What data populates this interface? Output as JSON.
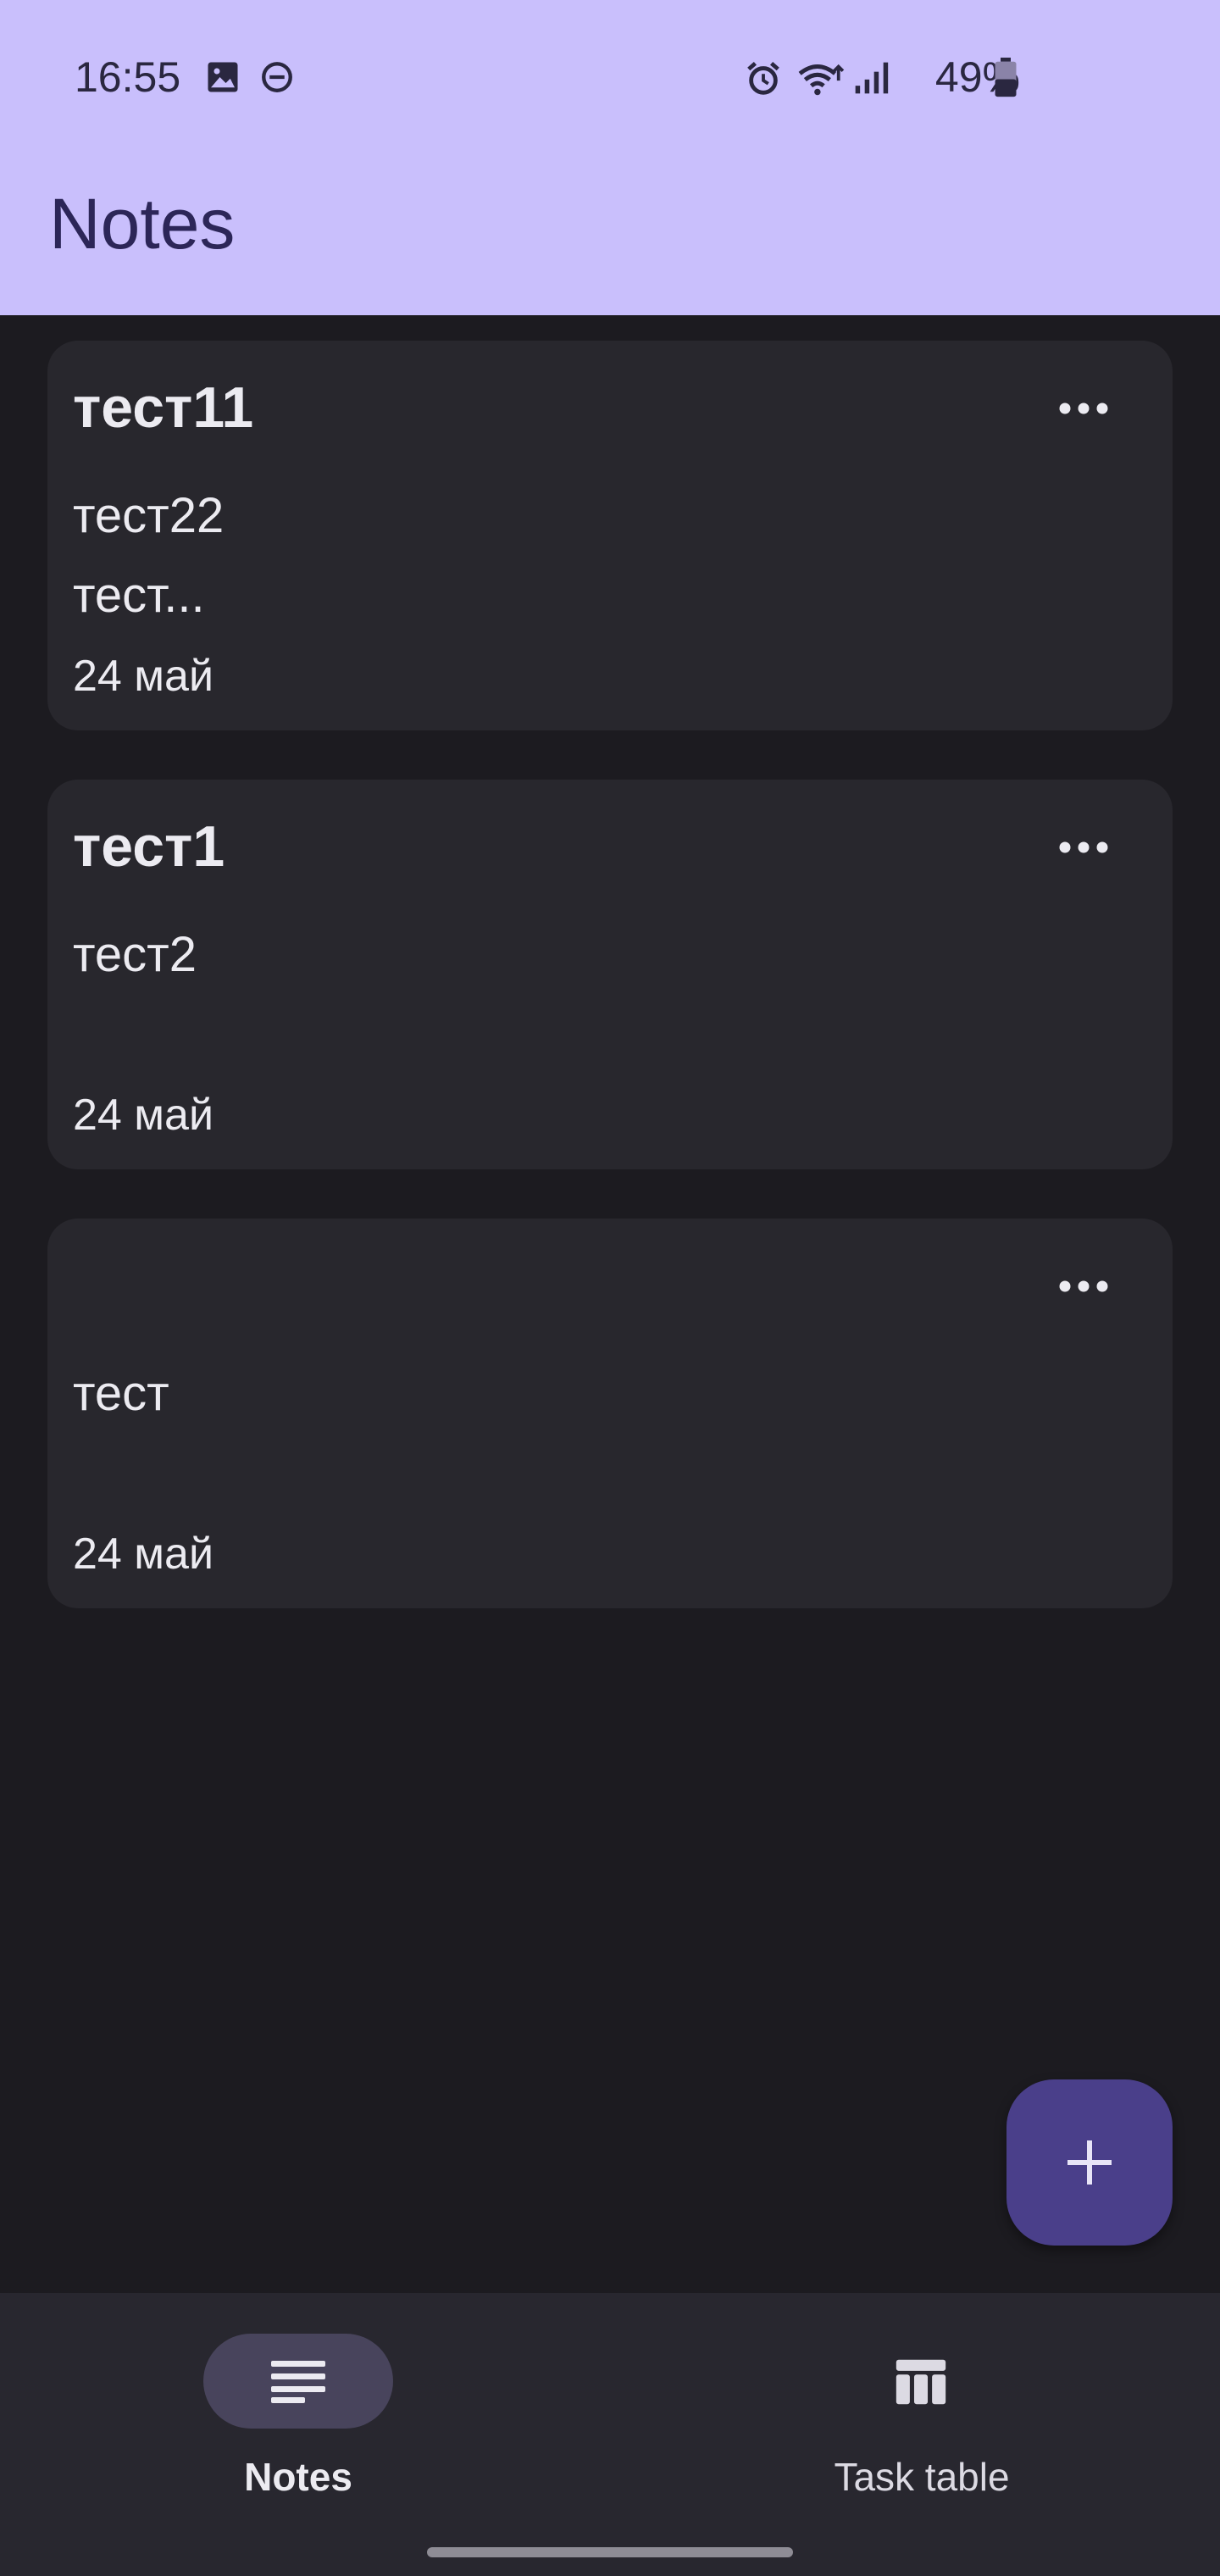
{
  "status_bar": {
    "time": "16:55",
    "battery": "49%",
    "left_icons": [
      "image-icon",
      "dnd-icon"
    ],
    "right_icons": [
      "alarm-icon",
      "wifi-icon",
      "signal-icon",
      "battery-icon"
    ]
  },
  "app_bar": {
    "title": "Notes"
  },
  "notes": [
    {
      "title": "тест11",
      "body": "тест22\nтест...",
      "date": "24 май"
    },
    {
      "title": "тест1",
      "body": "тест2",
      "date": "24 май"
    },
    {
      "title": "",
      "body": "тест",
      "date": "24 май"
    }
  ],
  "fab": {
    "icon": "plus-icon"
  },
  "bottom_nav": {
    "items": [
      {
        "label": "Notes",
        "icon": "notes-icon",
        "active": true
      },
      {
        "label": "Task table",
        "icon": "table-icon",
        "active": false
      }
    ]
  },
  "colors": {
    "app_bar": "#c9bffc",
    "background": "#1c1b20",
    "card": "#28272d",
    "fab": "#4a3f8a",
    "nav": "#28272f",
    "active_pill": "#48445c"
  }
}
